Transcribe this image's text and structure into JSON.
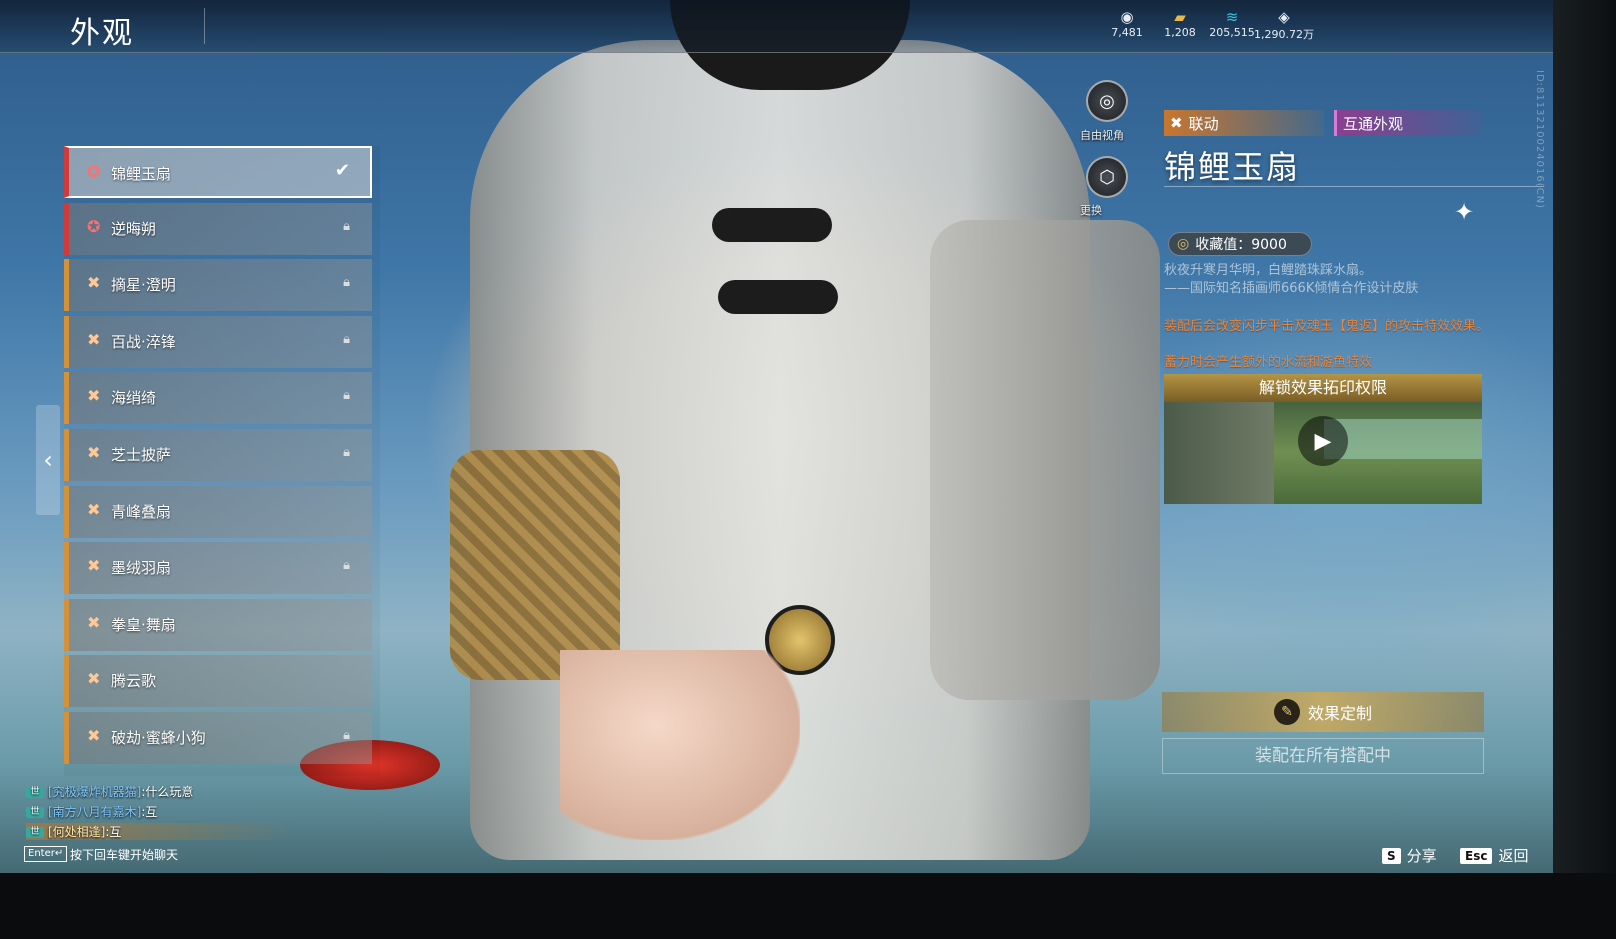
{
  "header": {
    "title": "外观",
    "currencies": [
      {
        "icon": "gem-eye-icon",
        "glyph": "◉",
        "value": "7,481"
      },
      {
        "icon": "gold-bar-icon",
        "glyph": "▰",
        "value": "1,208"
      },
      {
        "icon": "feather-icon",
        "glyph": "≋",
        "value": "205,515"
      },
      {
        "icon": "diamond-icon",
        "glyph": "◈",
        "value": "1,290.72万"
      }
    ]
  },
  "skin_list": {
    "items": [
      {
        "label": "锦鲤玉扇",
        "rarity": "red",
        "locked": false,
        "selected": true
      },
      {
        "label": "逆晦朔",
        "rarity": "red",
        "locked": true,
        "selected": false
      },
      {
        "label": "摘星·澄明",
        "rarity": "gold",
        "locked": true,
        "selected": false
      },
      {
        "label": "百战·淬锋",
        "rarity": "gold",
        "locked": true,
        "selected": false
      },
      {
        "label": "海绡绮",
        "rarity": "gold",
        "locked": true,
        "selected": false
      },
      {
        "label": "芝士披萨",
        "rarity": "gold",
        "locked": true,
        "selected": false
      },
      {
        "label": "青峰叠扇",
        "rarity": "gold",
        "locked": false,
        "selected": false
      },
      {
        "label": "墨绒羽扇",
        "rarity": "gold",
        "locked": true,
        "selected": false
      },
      {
        "label": "拳皇·舞扇",
        "rarity": "gold",
        "locked": false,
        "selected": false
      },
      {
        "label": "腾云歌",
        "rarity": "gold",
        "locked": false,
        "selected": false
      },
      {
        "label": "破劫·蜜蜂小狗",
        "rarity": "gold",
        "locked": true,
        "selected": false
      }
    ]
  },
  "camera_controls": {
    "free_view_label": "自由视角",
    "change_label": "更换"
  },
  "detail": {
    "tag_collab": "联动",
    "tag_shared": "互通外观",
    "name": "锦鲤玉扇",
    "collection_label": "收藏值：9000",
    "desc_gray_1": "秋夜升寒月华明，白鲤踏珠踩水扇。",
    "desc_gray_2": "——国际知名插画师666K倾情合作设计皮肤",
    "desc_orange_1": "装配后会改变闪步平击及魂玉【鬼返】的攻击特效效果。",
    "desc_orange_2": "蓄力时会产生额外的水流和游鱼特效",
    "video_title": "解锁效果拓印权限",
    "custom_button": "效果定制",
    "equip_status": "装配在所有搭配中"
  },
  "chat": {
    "messages": [
      {
        "channel": "世",
        "name": "[究极爆炸机器猫]",
        "text": ":什么玩意"
      },
      {
        "channel": "世",
        "name": "[南方八月有嘉木]",
        "text": ":互"
      },
      {
        "channel": "世",
        "name": "[何处相逢]",
        "text": ":互"
      }
    ],
    "enter_key": "Enter↵",
    "enter_hint": "按下回车键开始聊天"
  },
  "footer": {
    "share_key": "S",
    "share_label": "分享",
    "back_key": "Esc",
    "back_label": "返回"
  },
  "version_id": "ID:8113210024016(CN)"
}
